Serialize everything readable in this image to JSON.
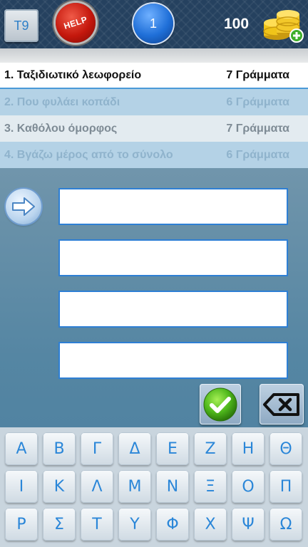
{
  "header": {
    "t9_label": "T9",
    "help_label": "HELP",
    "level": "1",
    "coins": "100"
  },
  "clues": [
    {
      "num": "1.",
      "text": "Ταξιδιωτικό λεωφορείο",
      "length": "7 Γράμματα",
      "state": "active"
    },
    {
      "num": "2.",
      "text": "Που φυλάει κοπάδι",
      "length": "6 Γράμματα",
      "state": "alt1"
    },
    {
      "num": "3.",
      "text": "Καθόλου όμορφος",
      "length": "7 Γράμματα",
      "state": "alt2"
    },
    {
      "num": "4.",
      "text": "Βγάζω μέρος από το σύνολο",
      "length": "6 Γράμματα",
      "state": "alt1"
    }
  ],
  "answers": [
    "",
    "",
    "",
    ""
  ],
  "keyboard": {
    "rows": [
      [
        "Α",
        "Β",
        "Γ",
        "Δ",
        "Ε",
        "Ζ",
        "Η",
        "Θ"
      ],
      [
        "Ι",
        "Κ",
        "Λ",
        "Μ",
        "Ν",
        "Ξ",
        "Ο",
        "Π"
      ],
      [
        "Ρ",
        "Σ",
        "Τ",
        "Υ",
        "Φ",
        "Χ",
        "Ψ",
        "Ω"
      ]
    ]
  },
  "colors": {
    "accent": "#2a86d8",
    "top_bar": "#25415f",
    "help_red": "#c4170c",
    "confirm_green": "#4fb81c"
  }
}
